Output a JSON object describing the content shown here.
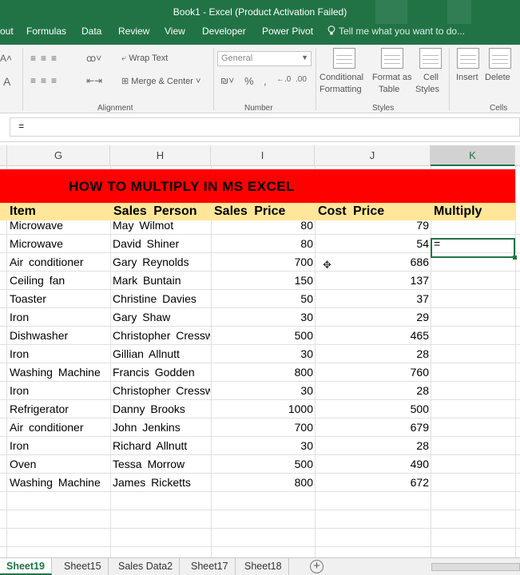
{
  "window": {
    "title": "Book1 - Excel (Product Activation Failed)"
  },
  "ribbon_tabs": [
    "out",
    "Formulas",
    "Data",
    "Review",
    "View",
    "Developer",
    "Power Pivot"
  ],
  "tell_me": "Tell me what you want to do...",
  "ribbon": {
    "wrap_text": "Wrap Text",
    "merge_center": "Merge & Center",
    "number_format": "General",
    "conditional_formatting": [
      "Conditional",
      "Formatting"
    ],
    "format_as_table": [
      "Format as",
      "Table"
    ],
    "cell_styles": [
      "Cell",
      "Styles"
    ],
    "insert": "Insert",
    "delete": "Delete",
    "groups": {
      "alignment": "Alignment",
      "number": "Number",
      "styles": "Styles",
      "cells": "Cells"
    }
  },
  "formula_bar": {
    "value": "="
  },
  "columns": [
    "G",
    "H",
    "I",
    "J",
    "K"
  ],
  "active_column": "K",
  "sheet": {
    "banner": "HOW TO MULTIPLY IN MS EXCEL",
    "headers": [
      "Item",
      "Sales Person",
      "Sales Price",
      "Cost Price",
      "Multiply"
    ],
    "rows": [
      [
        "Microwave",
        "May Wilmot",
        "80",
        "79",
        ""
      ],
      [
        "Microwave",
        "David Shiner",
        "80",
        "54",
        "="
      ],
      [
        "Air conditioner",
        "Gary Reynolds",
        "700",
        "686",
        ""
      ],
      [
        "Ceiling fan",
        "Mark Buntain",
        "150",
        "137",
        ""
      ],
      [
        "Toaster",
        "Christine Davies",
        "50",
        "37",
        ""
      ],
      [
        "Iron",
        "Gary Shaw",
        "30",
        "29",
        ""
      ],
      [
        "Dishwasher",
        "Christopher Cressw",
        "500",
        "465",
        ""
      ],
      [
        "Iron",
        "Gillian Allnutt",
        "30",
        "28",
        ""
      ],
      [
        "Washing Machine",
        "Francis Godden",
        "800",
        "760",
        ""
      ],
      [
        "Iron",
        "Christopher Cressw",
        "30",
        "28",
        ""
      ],
      [
        "Refrigerator",
        "Danny Brooks",
        "1000",
        "500",
        ""
      ],
      [
        "Air conditioner",
        "John Jenkins",
        "700",
        "679",
        ""
      ],
      [
        "Iron",
        "Richard Allnutt",
        "30",
        "28",
        ""
      ],
      [
        "Oven",
        "Tessa Morrow",
        "500",
        "490",
        ""
      ],
      [
        "Washing Machine",
        "James Ricketts",
        "800",
        "672",
        ""
      ]
    ]
  },
  "sheet_tabs": [
    "Sheet19",
    "Sheet15",
    "Sales Data2",
    "Sheet17",
    "Sheet18"
  ],
  "active_sheet": "Sheet19",
  "colors": {
    "excel_green": "#217346",
    "banner_red": "#ff0000",
    "header_fill": "#ffe699"
  }
}
